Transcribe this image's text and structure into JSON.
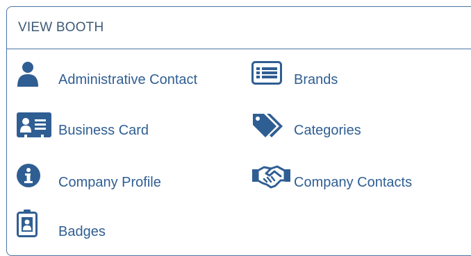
{
  "panel": {
    "title": "VIEW BOOTH"
  },
  "links": [
    {
      "label": "Administrative Contact",
      "icon": "user-icon"
    },
    {
      "label": "Brands",
      "icon": "list-icon"
    },
    {
      "label": "Business Card",
      "icon": "contact-card-icon"
    },
    {
      "label": "Categories",
      "icon": "tags-icon"
    },
    {
      "label": "Company Profile",
      "icon": "info-circle-icon"
    },
    {
      "label": "Company Contacts",
      "icon": "handshake-icon"
    },
    {
      "label": "Badges",
      "icon": "id-badge-icon"
    }
  ],
  "colors": {
    "accent": "#2f5e93",
    "border": "#4a74a5",
    "title": "#3e5a76"
  }
}
